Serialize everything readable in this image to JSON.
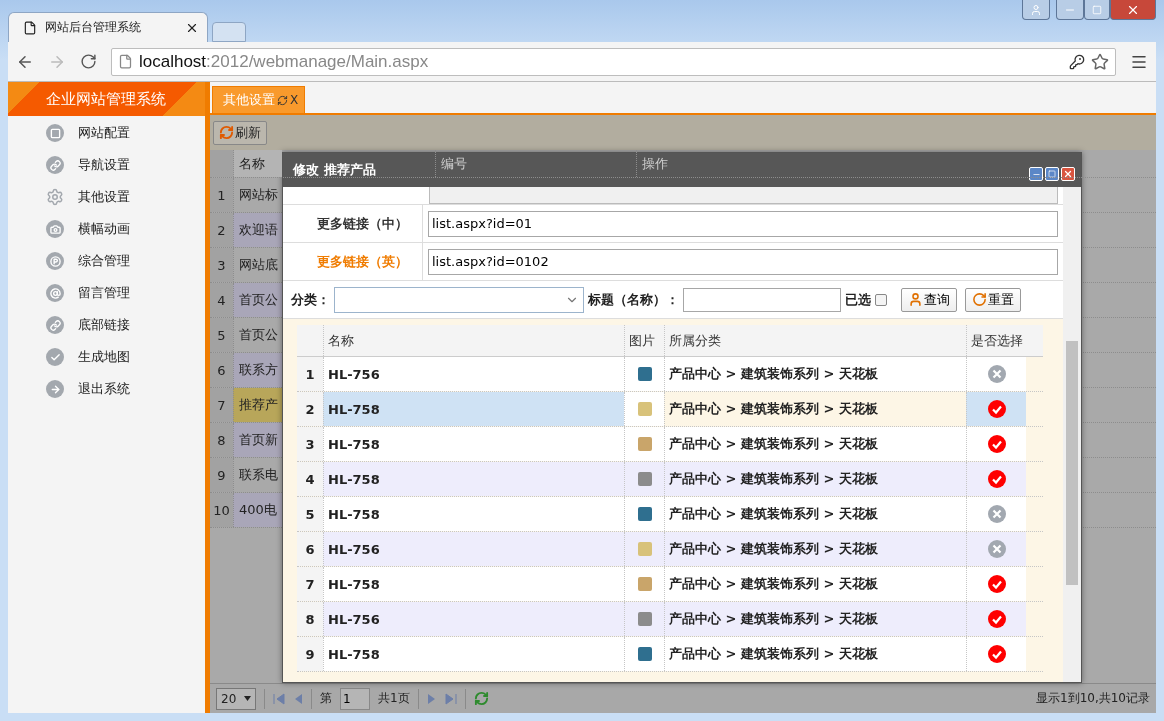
{
  "browser": {
    "tab_title": "网站后台管理系统",
    "address": {
      "host": "localhost",
      "path": ":2012/webmanage/Main.aspx"
    }
  },
  "sidebar": {
    "title": "企业网站管理系统",
    "items": [
      {
        "label": "网站配置"
      },
      {
        "label": "导航设置"
      },
      {
        "label": "其他设置"
      },
      {
        "label": "横幅动画"
      },
      {
        "label": "综合管理"
      },
      {
        "label": "留言管理"
      },
      {
        "label": "底部链接"
      },
      {
        "label": "生成地图"
      },
      {
        "label": "退出系统"
      }
    ]
  },
  "tabs": [
    {
      "label": "其他设置",
      "selected": true,
      "close": "X"
    }
  ],
  "toolbar": {
    "refresh": "刷新"
  },
  "grid": {
    "columns": [
      "名称",
      "编号",
      "操作"
    ],
    "rows": [
      {
        "num": "1",
        "name": "网站标",
        "selected": false
      },
      {
        "num": "2",
        "name": "欢迎语",
        "selected": false
      },
      {
        "num": "3",
        "name": "网站底",
        "selected": false
      },
      {
        "num": "4",
        "name": "首页公",
        "selected": false
      },
      {
        "num": "5",
        "name": "首页公",
        "selected": false
      },
      {
        "num": "6",
        "name": "联系方",
        "selected": false
      },
      {
        "num": "7",
        "name": "推荐产",
        "selected": true
      },
      {
        "num": "8",
        "name": "首页新",
        "selected": false
      },
      {
        "num": "9",
        "name": "联系电",
        "selected": false
      },
      {
        "num": "10",
        "name": "400电",
        "selected": false
      }
    ]
  },
  "dialog": {
    "title": "修改 推荐产品",
    "fields": [
      {
        "label": "更多链接（中）",
        "value": "list.aspx?id=01",
        "highlighted": false
      },
      {
        "label": "更多链接（英）",
        "value": "list.aspx?id=0102",
        "highlighted": true
      }
    ],
    "filter": {
      "category_label": "分类：",
      "title_label": "标题（名称）：",
      "chosen_label": "已选",
      "chosen_checked": false,
      "search": "查询",
      "reset": "重置"
    },
    "table": {
      "columns": [
        "名称",
        "图片",
        "所属分类",
        "是否选择"
      ],
      "rows": [
        {
          "num": "1",
          "name": "HL-756",
          "category": "产品中心 > 建筑装饰系列 > 天花板",
          "chosen": false,
          "selected": false
        },
        {
          "num": "2",
          "name": "HL-758",
          "category": "产品中心 > 建筑装饰系列 > 天花板",
          "chosen": true,
          "selected": true
        },
        {
          "num": "3",
          "name": "HL-758",
          "category": "产品中心 > 建筑装饰系列 > 天花板",
          "chosen": true,
          "selected": false
        },
        {
          "num": "4",
          "name": "HL-758",
          "category": "产品中心 > 建筑装饰系列 > 天花板",
          "chosen": true,
          "selected": false
        },
        {
          "num": "5",
          "name": "HL-758",
          "category": "产品中心 > 建筑装饰系列 > 天花板",
          "chosen": false,
          "selected": false
        },
        {
          "num": "6",
          "name": "HL-756",
          "category": "产品中心 > 建筑装饰系列 > 天花板",
          "chosen": false,
          "selected": false
        },
        {
          "num": "7",
          "name": "HL-758",
          "category": "产品中心 > 建筑装饰系列 > 天花板",
          "chosen": true,
          "selected": false
        },
        {
          "num": "8",
          "name": "HL-756",
          "category": "产品中心 > 建筑装饰系列 > 天花板",
          "chosen": true,
          "selected": false
        },
        {
          "num": "9",
          "name": "HL-758",
          "category": "产品中心 > 建筑装饰系列 > 天花板",
          "chosen": true,
          "selected": false
        }
      ]
    }
  },
  "pager": {
    "page_size": "20",
    "page_prefix": "第",
    "page": "1",
    "page_total": "共1页",
    "summary": "显示1到10,共10记录"
  }
}
